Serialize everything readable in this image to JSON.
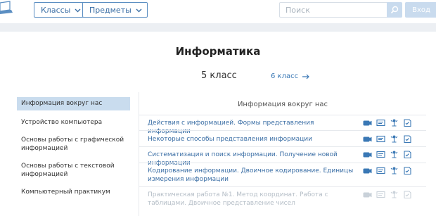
{
  "header": {
    "classes_label": "Классы",
    "subjects_label": "Предметы",
    "search_placeholder": "Поиск",
    "login_label": "Вход"
  },
  "subject": {
    "title": "Информатика",
    "grade_current": "5 класс",
    "grade_next": "6 класс"
  },
  "sidebar": {
    "items": [
      {
        "label": "Информация вокруг нас",
        "active": true
      },
      {
        "label": "Устройство компьютера"
      },
      {
        "label": "Основы работы с графической информацией"
      },
      {
        "label": "Основы работы с текстовой информацией"
      },
      {
        "label": "Компьютерный практикум"
      }
    ]
  },
  "lessons": {
    "header": "Информация вокруг нас",
    "items": [
      {
        "title": "Действия с информацией. Формы представления информации",
        "disabled": false
      },
      {
        "title": "Некоторые способы представления информации",
        "disabled": false
      },
      {
        "title": "Систематизация и поиск информации. Получение новой информации",
        "disabled": false
      },
      {
        "title": "Кодирование информации. Двоичное кодирование. Единицы измерения информации",
        "disabled": false
      },
      {
        "title": "Практическая работа №1. Метод координат. Работа с таблицами. Двоичное представление чисел",
        "disabled": true
      }
    ],
    "icon_names": [
      "video-icon",
      "presentation-icon",
      "test-icon",
      "homework-icon"
    ]
  },
  "colors": {
    "accent": "#3a6ea5",
    "active_bg": "#c9dcee",
    "disabled": "#b5bec7",
    "band": "#eceff3"
  }
}
